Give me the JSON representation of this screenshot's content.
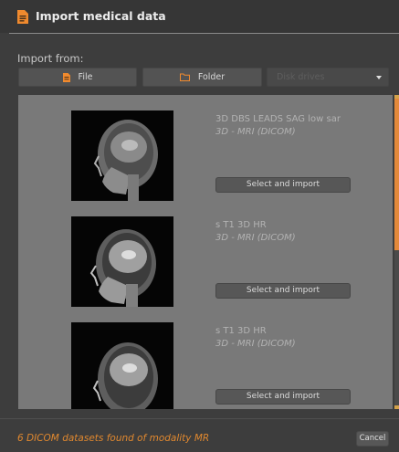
{
  "dialog": {
    "title": "Import medical data"
  },
  "import_from": {
    "label": "Import from:",
    "file_label": "File",
    "folder_label": "Folder",
    "disk_drives_value": "Disk drives"
  },
  "datasets": [
    {
      "name": "3D DBS LEADS SAG low sar",
      "type": "3D - MRI (DICOM)",
      "button": "Select and import"
    },
    {
      "name": "s T1 3D HR",
      "type": "3D - MRI (DICOM)",
      "button": "Select and import"
    },
    {
      "name": "s T1 3D HR",
      "type": "3D - MRI (DICOM)",
      "button": "Select and import"
    }
  ],
  "status": {
    "text": "6 DICOM datasets found of modality MR"
  },
  "footer": {
    "cancel_label": "Cancel"
  },
  "colors": {
    "accent": "#e0882f",
    "background": "#3d3d3d",
    "panel": "#797979",
    "button": "#535353"
  },
  "icons": [
    "document-icon",
    "file-icon",
    "folder-icon",
    "chevron-down-icon"
  ]
}
